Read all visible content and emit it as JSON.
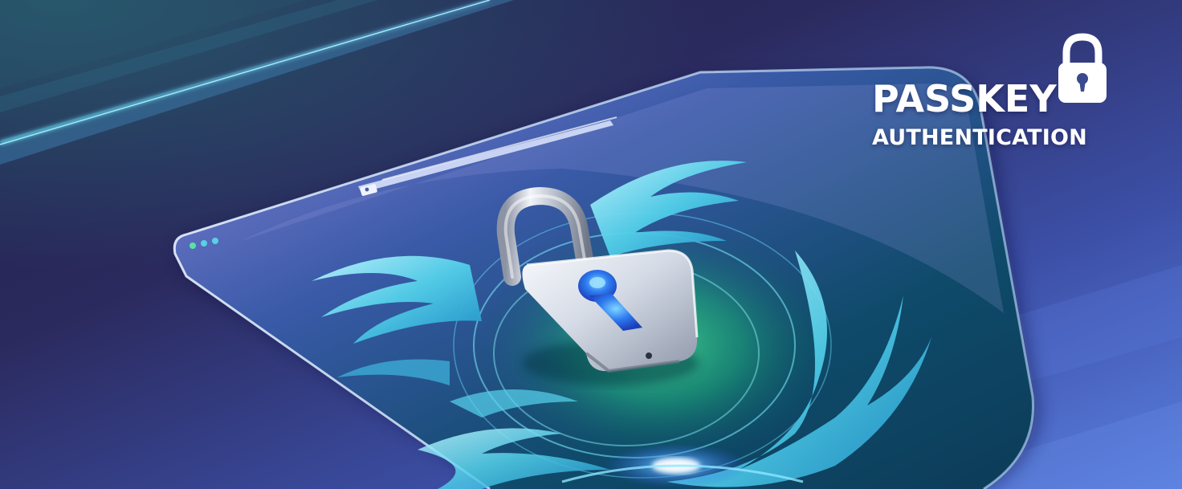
{
  "heading": {
    "line1": "PASSKEY",
    "line2": "AUTHENTICATION"
  },
  "icons": {
    "corner": "padlock-icon",
    "center": "padlock-icon",
    "window_controls": "traffic-light-dots-icon"
  },
  "colors": {
    "background_dark": "#1b1d45",
    "background_purple": "#5b4f9e",
    "background_blue": "#4a6fd0",
    "glow_cyan": "#5fe3f0",
    "swirl_teal": "#43c7e8",
    "glow_green": "#36d38a",
    "keyhole_blue": "#2f7bf0",
    "lock_silver": "#d5dbe6",
    "text": "#ffffff"
  }
}
